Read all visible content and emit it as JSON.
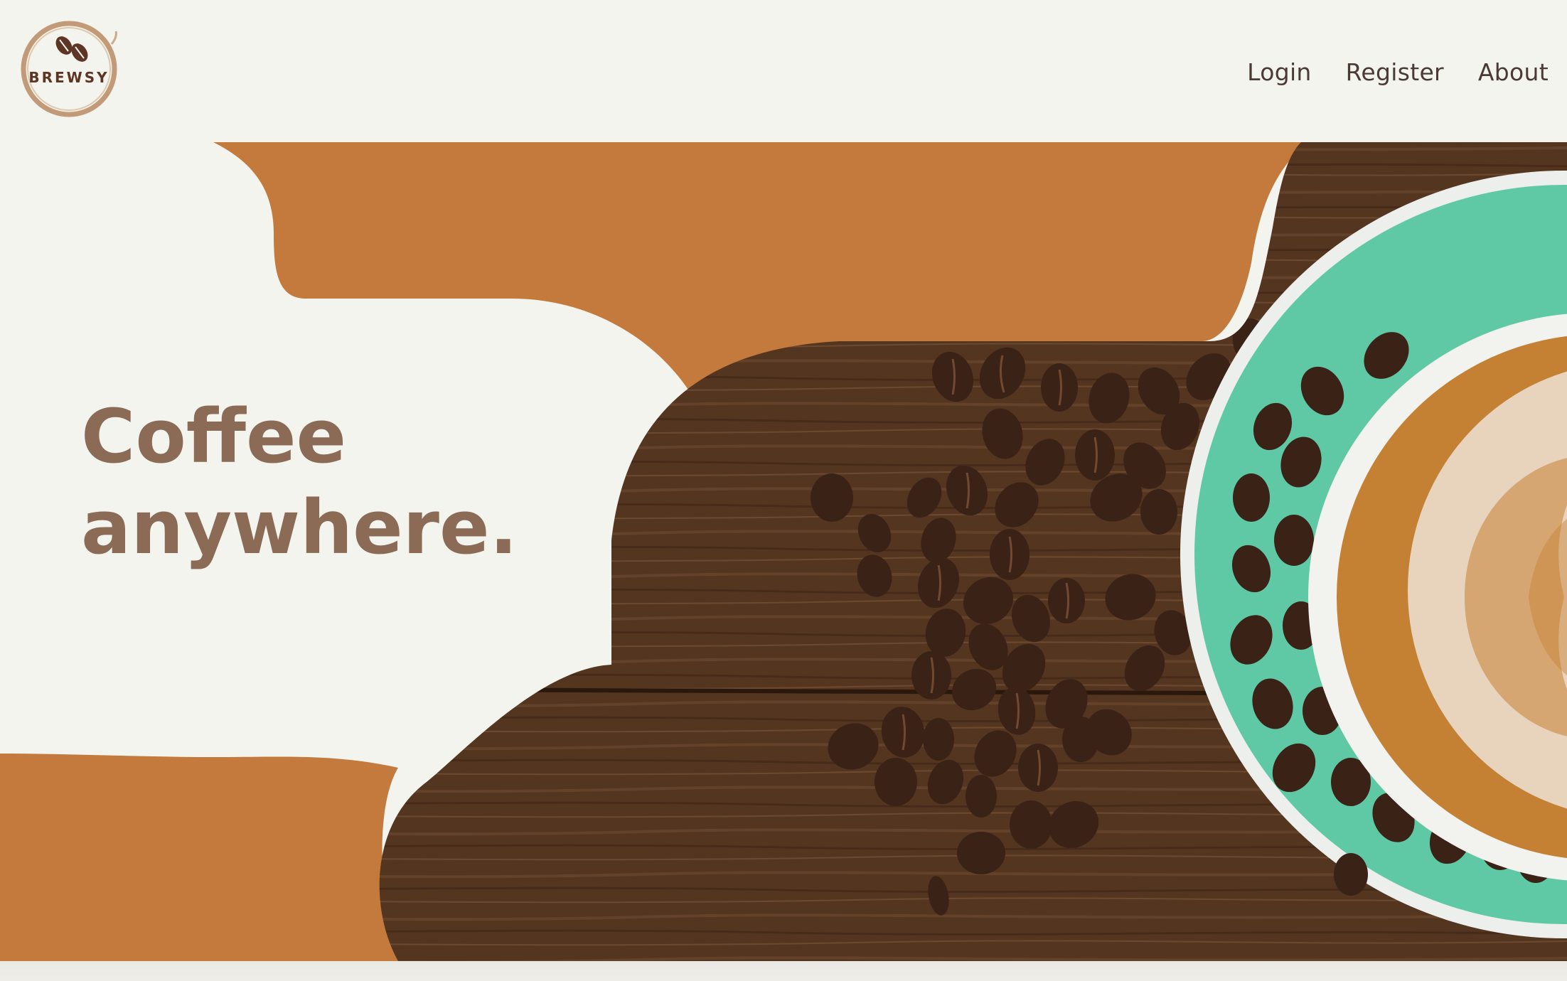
{
  "brand": {
    "name": "BREWSY",
    "logo_icon": "coffee-bean-stamp-icon"
  },
  "nav": {
    "login": "Login",
    "register": "Register",
    "about": "About"
  },
  "hero": {
    "headline_line1": "Coffee",
    "headline_line2": "anywhere.",
    "image": "coffee-beans-and-latte-on-wooden-table"
  },
  "colors": {
    "background": "#f4f4ef",
    "accent": "#c47a3c",
    "headline": "#8b6a56",
    "nav_text": "#4a3a33",
    "saucer": "#5fc9a6",
    "wood": "#5a3a24"
  }
}
